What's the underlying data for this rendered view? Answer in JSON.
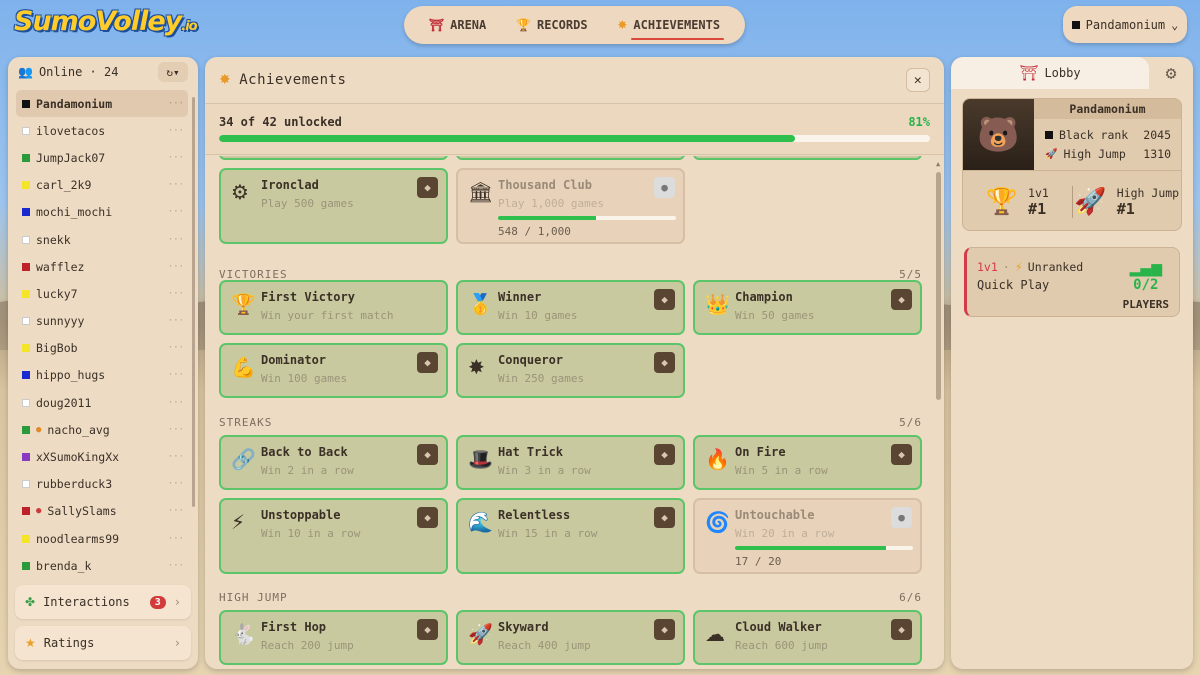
{
  "logo": {
    "main": "SumoVolley",
    "suffix": ".io"
  },
  "nav": {
    "items": [
      {
        "icon": "⛩",
        "label": "ARENA"
      },
      {
        "icon": "🏆",
        "label": "RECORDS"
      },
      {
        "icon": "✸",
        "label": "ACHIEVEMENTS"
      }
    ]
  },
  "user": {
    "name": "Pandamonium",
    "chevron": "⌄"
  },
  "online": {
    "label": "Online · 24",
    "refresh": "↻▾"
  },
  "players": [
    {
      "name": "Pandamonium",
      "color": "#111111"
    },
    {
      "name": "ilovetacos",
      "color": "#ffffff"
    },
    {
      "name": "JumpJack07",
      "color": "#2a9a3a"
    },
    {
      "name": "carl_2k9",
      "color": "#f5e52a"
    },
    {
      "name": "mochi_mochi",
      "color": "#1a2ad0"
    },
    {
      "name": "snekk",
      "color": "#ffffff"
    },
    {
      "name": "wafflez",
      "color": "#c0202a"
    },
    {
      "name": "lucky7",
      "color": "#f5e52a"
    },
    {
      "name": "sunnyyy",
      "color": "#ffffff"
    },
    {
      "name": "BigBob",
      "color": "#f5e52a"
    },
    {
      "name": "hippo_hugs",
      "color": "#1a2ad0"
    },
    {
      "name": "doug2011",
      "color": "#ffffff"
    },
    {
      "name": "nacho_avg",
      "color": "#2a9a3a",
      "dot": "orange"
    },
    {
      "name": "xXSumoKingXx",
      "color": "#8a3ac0"
    },
    {
      "name": "rubberduck3",
      "color": "#ffffff"
    },
    {
      "name": "SallySlams",
      "color": "#c0202a",
      "dot": "red"
    },
    {
      "name": "noodlearms99",
      "color": "#f5e52a"
    },
    {
      "name": "brenda_k",
      "color": "#2a9a3a"
    }
  ],
  "more": "···",
  "buttons": {
    "interactions": "Interactions",
    "interactions_count": "3",
    "ratings": "Ratings"
  },
  "achievements": {
    "title": "Achievements",
    "close": "✕",
    "summary": "34 of 42 unlocked",
    "percent": "81%",
    "progress": 0.81
  },
  "sections": {
    "victories": {
      "title": "VICTORIES",
      "count": "5/5"
    },
    "streaks": {
      "title": "STREAKS",
      "count": "5/6"
    },
    "highjump": {
      "title": "HIGH JUMP",
      "count": "6/6"
    }
  },
  "cards": [
    {
      "title": "Ironclad",
      "desc": "Play 500 games",
      "icon": "⚙"
    },
    {
      "title": "Thousand Club",
      "desc": "Play 1,000 games",
      "icon": "🏛",
      "progress": "548 / 1,000",
      "frac": 0.548
    },
    {
      "title": "First Victory",
      "desc": "Win your first match",
      "icon": "🏆"
    },
    {
      "title": "Winner",
      "desc": "Win 10 games",
      "icon": "🥇"
    },
    {
      "title": "Champion",
      "desc": "Win 50 games",
      "icon": "👑"
    },
    {
      "title": "Dominator",
      "desc": "Win 100 games",
      "icon": "💪"
    },
    {
      "title": "Conqueror",
      "desc": "Win 250 games",
      "icon": "✸"
    },
    {
      "title": "Back to Back",
      "desc": "Win 2 in a row",
      "icon": "🔗"
    },
    {
      "title": "Hat Trick",
      "desc": "Win 3 in a row",
      "icon": "🎩"
    },
    {
      "title": "On Fire",
      "desc": "Win 5 in a row",
      "icon": "🔥"
    },
    {
      "title": "Unstoppable",
      "desc": "Win 10 in a row",
      "icon": "⚡"
    },
    {
      "title": "Relentless",
      "desc": "Win 15 in a row",
      "icon": "🌊"
    },
    {
      "title": "Untouchable",
      "desc": "Win 20 in a row",
      "icon": "🌀",
      "progress": "17 / 20",
      "frac": 0.85
    },
    {
      "title": "First Hop",
      "desc": "Reach 200 jump",
      "icon": "🐇"
    },
    {
      "title": "Skyward",
      "desc": "Reach 400 jump",
      "icon": "🚀"
    },
    {
      "title": "Cloud Walker",
      "desc": "Reach 600 jump",
      "icon": "☁"
    }
  ],
  "lobby": {
    "tab": "Lobby",
    "tab_icon": "⛩",
    "gear": "⚙"
  },
  "profile": {
    "name": "Pandamonium",
    "avatar": "🐻",
    "rank_label": "Black rank",
    "rank_value": "2045",
    "hj_label": "High Jump",
    "hj_value": "1310",
    "m1_label": "1v1",
    "m1_rank": "#1",
    "m2_label": "High Jump",
    "m2_rank": "#1"
  },
  "quickplay": {
    "mode": "1v1",
    "sep": "·",
    "type": "Unranked",
    "title": "Quick Play",
    "count": "0/2",
    "players_label": "PLAYERS"
  }
}
